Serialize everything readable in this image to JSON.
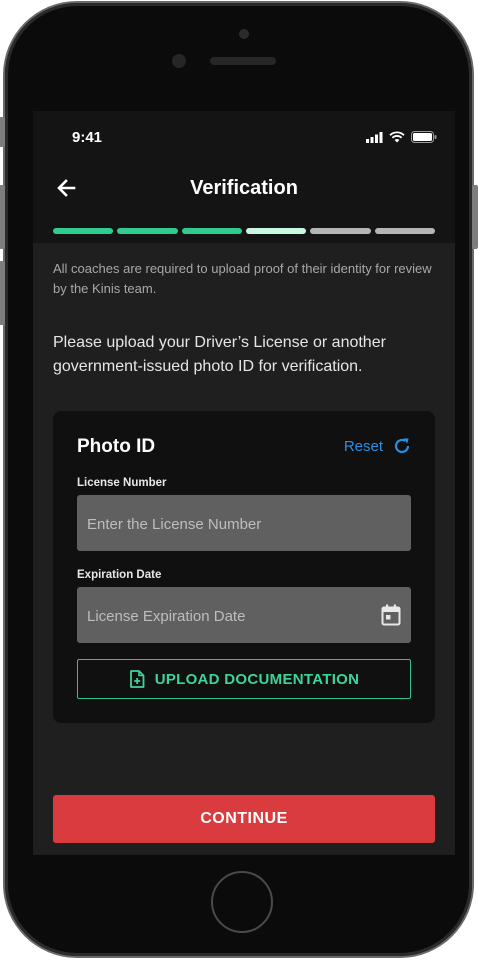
{
  "status_bar": {
    "time": "9:41"
  },
  "header": {
    "title": "Verification",
    "steps": [
      {
        "state": "complete",
        "color": "#2ecc8f"
      },
      {
        "state": "complete",
        "color": "#2ecc8f"
      },
      {
        "state": "complete",
        "color": "#2ecc8f"
      },
      {
        "state": "current",
        "color": "#c9f7e3"
      },
      {
        "state": "pending",
        "color": "#b5b5b5"
      },
      {
        "state": "pending",
        "color": "#b5b5b5"
      }
    ]
  },
  "intro_text": "All coaches are required to upload proof of their identity for review by the Kinis team.",
  "instruction_text": "Please upload your Driver’s License or another government-issued photo ID for verification.",
  "card": {
    "title": "Photo ID",
    "reset_label": "Reset",
    "license_number": {
      "label": "License Number",
      "placeholder": "Enter the License Number",
      "value": ""
    },
    "expiration_date": {
      "label": "Expiration Date",
      "placeholder": "License Expiration Date",
      "value": ""
    },
    "upload_label": "UPLOAD DOCUMENTATION"
  },
  "continue_label": "CONTINUE",
  "colors": {
    "accent_green": "#2ecc8f",
    "link_blue": "#2a8fe0",
    "primary_red": "#d93b3e"
  },
  "icons": [
    "back-arrow-icon",
    "signal-icon",
    "wifi-icon",
    "battery-icon",
    "refresh-icon",
    "calendar-icon",
    "file-add-icon"
  ]
}
